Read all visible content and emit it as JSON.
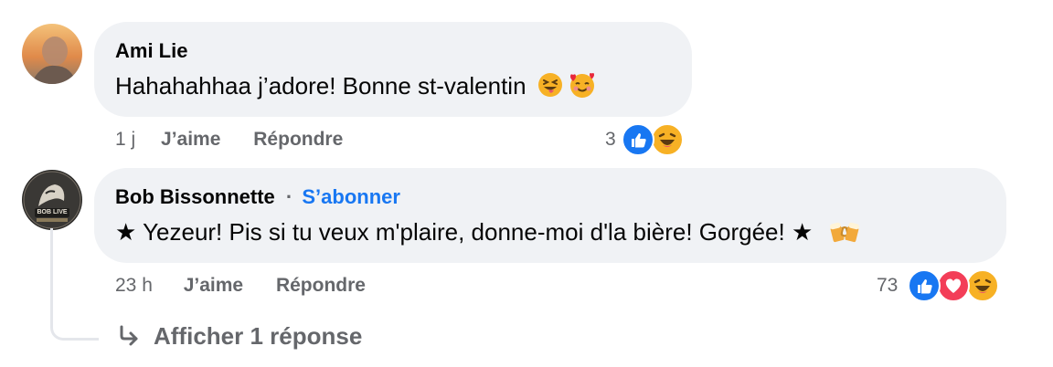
{
  "comments": [
    {
      "author": "Ami Lie",
      "text": "Hahahahhaa j’adore! Bonne st-valentin",
      "emojis": [
        "squinting-tongue-emoji",
        "smiling-hearts-emoji"
      ],
      "time": "1 j",
      "like_label": "J’aime",
      "reply_label": "Répondre",
      "reaction_count": "3",
      "reactions": [
        "like-icon",
        "haha-icon"
      ]
    },
    {
      "author": "Bob Bissonnette",
      "separator": "·",
      "follow_label": "S’abonner",
      "text": "★ Yezeur! Pis si tu veux m'plaire, donne-moi d'la bière! Gorgée! ★",
      "emojis": [
        "clinking-beer-mugs-emoji"
      ],
      "avatar_logo_text": "BOB LIVE",
      "time": "23 h",
      "like_label": "J’aime",
      "reply_label": "Répondre",
      "reaction_count": "73",
      "reactions": [
        "like-icon",
        "love-icon",
        "haha-icon"
      ]
    }
  ],
  "view_replies_label": "Afficher 1 réponse",
  "colors": {
    "bubble": "#f0f2f5",
    "meta": "#65676b",
    "link": "#1877f2",
    "like": "#1877f2",
    "love": "#f33e58",
    "haha": "#f7b125"
  }
}
